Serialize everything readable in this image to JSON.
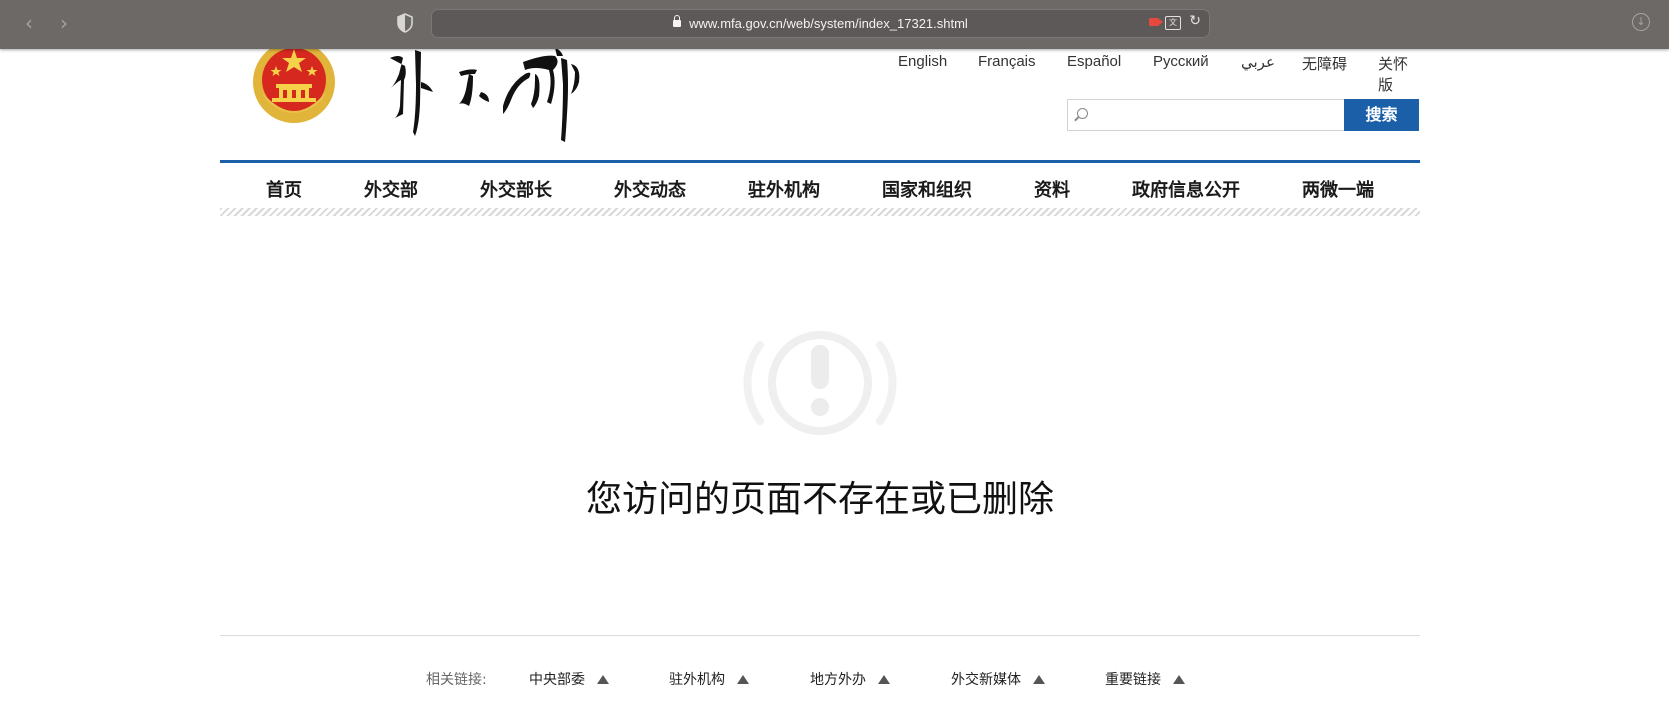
{
  "browser": {
    "url": "www.mfa.gov.cn/web/system/index_17321.shtml"
  },
  "header": {
    "languages": [
      "English",
      "Français",
      "Español",
      "Русский",
      "عربي",
      "无障碍",
      "关怀版"
    ],
    "search": {
      "placeholder": "",
      "button_label": "搜索"
    }
  },
  "nav": {
    "items": [
      "首页",
      "外交部",
      "外交部长",
      "外交动态",
      "驻外机构",
      "国家和组织",
      "资料",
      "政府信息公开",
      "两微一端"
    ]
  },
  "error": {
    "message": "您访问的页面不存在或已删除"
  },
  "footer": {
    "label": "相关链接:",
    "links": [
      "中央部委",
      "驻外机构",
      "地方外办",
      "外交新媒体",
      "重要链接"
    ]
  },
  "colors": {
    "accent": "#1b5fa8",
    "toolbar": "#6c6967"
  }
}
